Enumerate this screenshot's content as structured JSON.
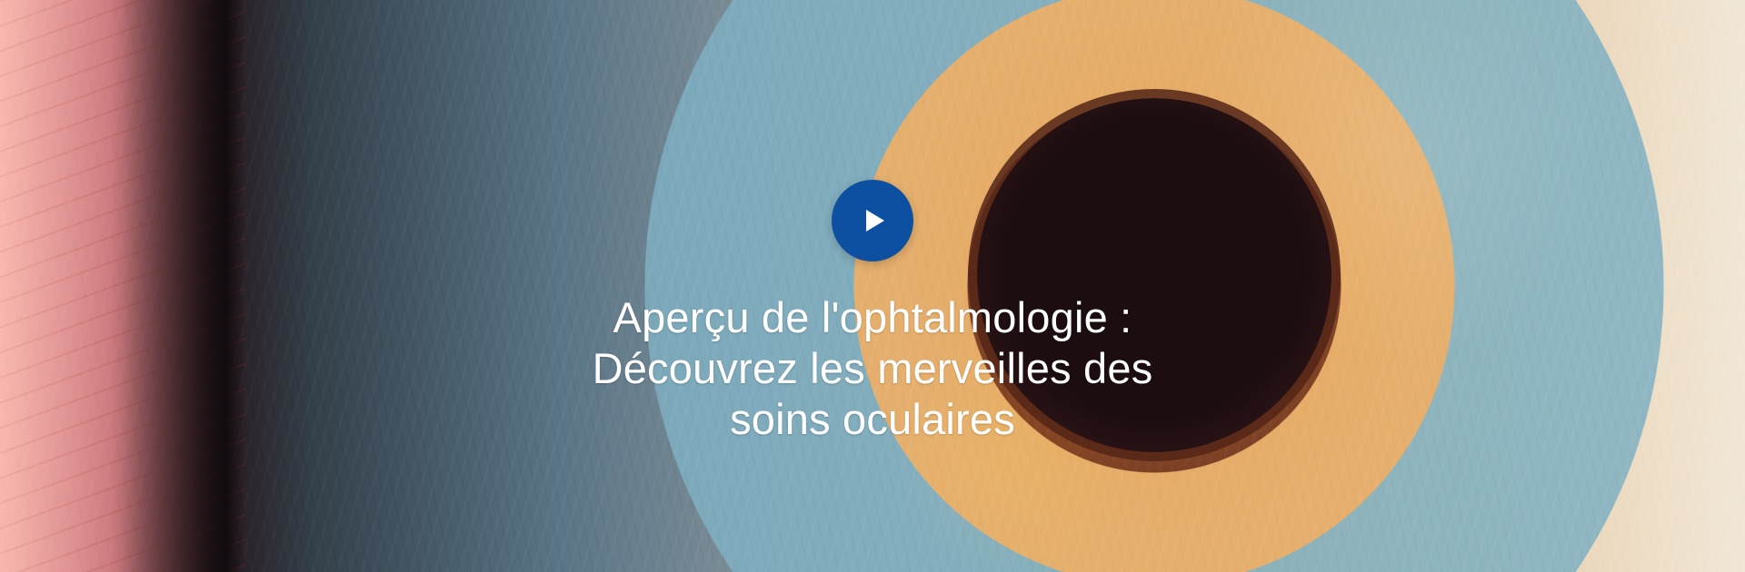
{
  "hero": {
    "title_lines": [
      "Aperçu de l'ophtalmologie :",
      "Découvrez les merveilles des",
      "soins oculaires"
    ],
    "play_button_icon": "play-icon",
    "accent_color": "#0d4fa1"
  }
}
